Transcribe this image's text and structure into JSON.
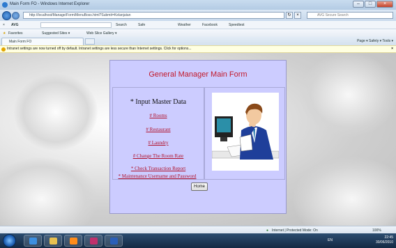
{
  "window": {
    "title": "Main Form FO - Windows Internet Explorer",
    "url": "http://localhost/Manage/Form/MenuBoss.html?Submit=Kelanjutan",
    "search_placeholder": "AVG Secure Search"
  },
  "toolbar": {
    "brand": "AVG",
    "search_label": "Search",
    "safe_label": "Safe",
    "weather_label": "Weather",
    "facebook_label": "Facebook",
    "speedtest_label": "Speedtest"
  },
  "favorites": {
    "label": "Favorites",
    "suggested": "Suggested Sites ▾",
    "gallery": "Web Slice Gallery ▾"
  },
  "tabs": {
    "active": "Main Form FO",
    "commands": "Page ▾  Safety ▾  Tools ▾"
  },
  "infobar": {
    "message": "Intranet settings are now turned off by default. Intranet settings are less secure than Internet settings. Click for options...",
    "close": "×"
  },
  "form": {
    "title": "General Manager Main Form",
    "master_heading": "* Input Master Data",
    "links": {
      "rooms": "# Rooms",
      "restaurant": "# Restaurant",
      "laundry": "# Laundry",
      "change_rate": "# Change The Room Rate",
      "check_report": "* Check Transaction Report",
      "maintenance": "* Maintenance Username and Password"
    },
    "home_button": "Home"
  },
  "status": {
    "zone": "Internet | Protected Mode: On",
    "zoom": "100%"
  },
  "taskbar": {
    "lang": "EN",
    "time": "22:45",
    "date": "30/06/2010"
  },
  "colors": {
    "form_bg": "#ccccff",
    "title_red": "#c2182a",
    "link_red": "#b0102a"
  }
}
